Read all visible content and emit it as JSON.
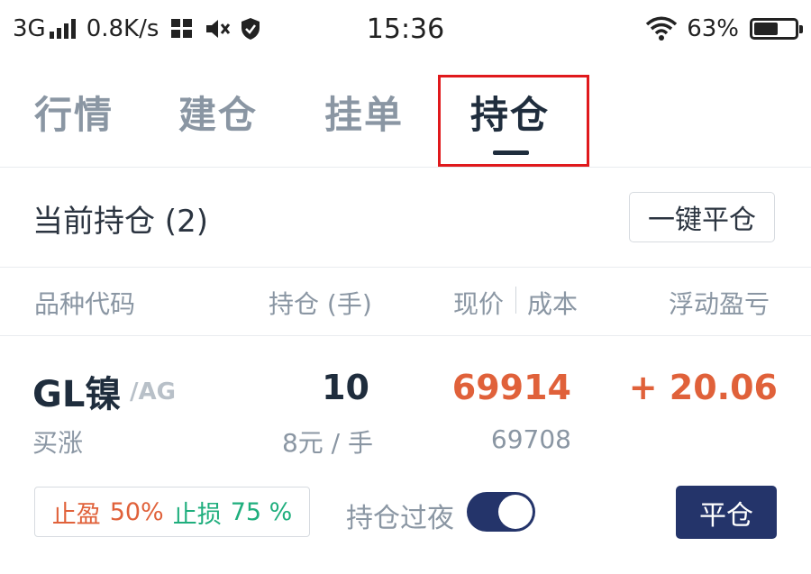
{
  "status_bar": {
    "network": "3G",
    "speed": "0.8K/s",
    "time": "15:36",
    "battery": "63%",
    "battery_level": 0.63,
    "icons": [
      "signal-icon",
      "data-transfer-icon",
      "mute-icon",
      "shield-icon",
      "wifi-icon",
      "battery-icon"
    ]
  },
  "tabs": [
    {
      "label": "行情",
      "active": false
    },
    {
      "label": "建仓",
      "active": false
    },
    {
      "label": "挂单",
      "active": false
    },
    {
      "label": "持仓",
      "active": true
    }
  ],
  "section": {
    "title": "当前持仓 (2)",
    "close_all_label": "一键平仓"
  },
  "columns": {
    "symbol": "品种代码",
    "quantity": "持仓 (手)",
    "price": "现价",
    "cost": "成本",
    "pnl": "浮动盈亏"
  },
  "position": {
    "symbol": "GL镍",
    "exchange": "/AG",
    "direction": "买涨",
    "quantity": "10",
    "unit": "8元 / 手",
    "current_price": "69914",
    "cost": "69708",
    "pnl": "+ 20.06",
    "take_profit_label": "止盈",
    "take_profit_value": "50%",
    "stop_loss_label": "止损",
    "stop_loss_value": "75 %",
    "overnight_label": "持仓过夜",
    "overnight_enabled": true,
    "close_label": "平仓"
  },
  "colors": {
    "primary": "#24346a",
    "profit": "#e0613a",
    "loss_green": "#1fae7d",
    "highlight": "#e0191c",
    "muted": "#8a96a3"
  }
}
